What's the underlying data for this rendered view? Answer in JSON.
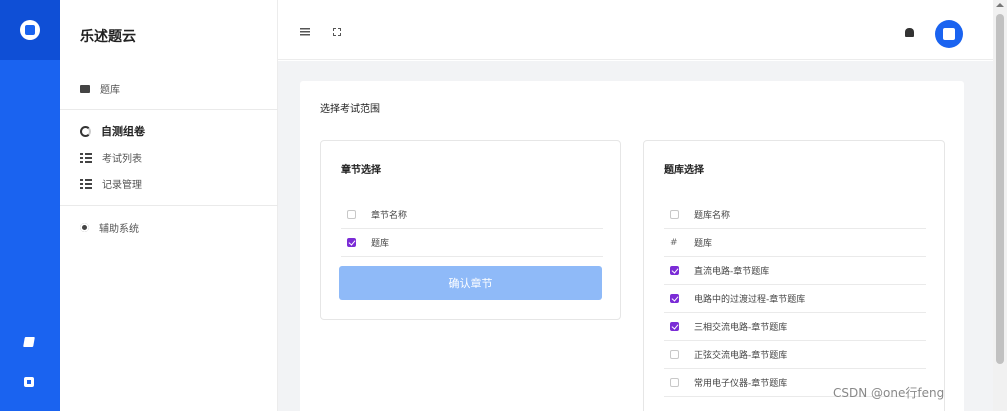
{
  "app": {
    "title": "乐述题云"
  },
  "sidebar": {
    "items": [
      {
        "label": "题库",
        "icon": "folder-icon"
      },
      {
        "label": "自测组卷",
        "icon": "ring-icon",
        "active": true
      },
      {
        "label": "考试列表",
        "icon": "list-icon"
      },
      {
        "label": "记录管理",
        "icon": "list-icon"
      },
      {
        "label": "辅助系统",
        "icon": "gear-icon"
      }
    ]
  },
  "main": {
    "card_title": "选择考试范围",
    "chapter_panel": {
      "title": "章节选择",
      "header": "章节名称",
      "rows": [
        {
          "label": "题库",
          "checked": true
        }
      ],
      "confirm_label": "确认章节"
    },
    "bank_panel": {
      "title": "题库选择",
      "header": "题库名称",
      "group_marker": "#",
      "group_label": "题库",
      "rows": [
        {
          "label": "直流电路-章节题库",
          "checked": true
        },
        {
          "label": "电路中的过渡过程-章节题库",
          "checked": true
        },
        {
          "label": "三相交流电路-章节题库",
          "checked": true
        },
        {
          "label": "正弦交流电路-章节题库",
          "checked": false
        },
        {
          "label": "常用电子仪器-章节题库",
          "checked": false
        }
      ]
    }
  },
  "watermark": "CSDN @one行feng",
  "colors": {
    "accent": "#1a63f0",
    "check": "#7b2cd6",
    "button": "#8fbaf8"
  }
}
